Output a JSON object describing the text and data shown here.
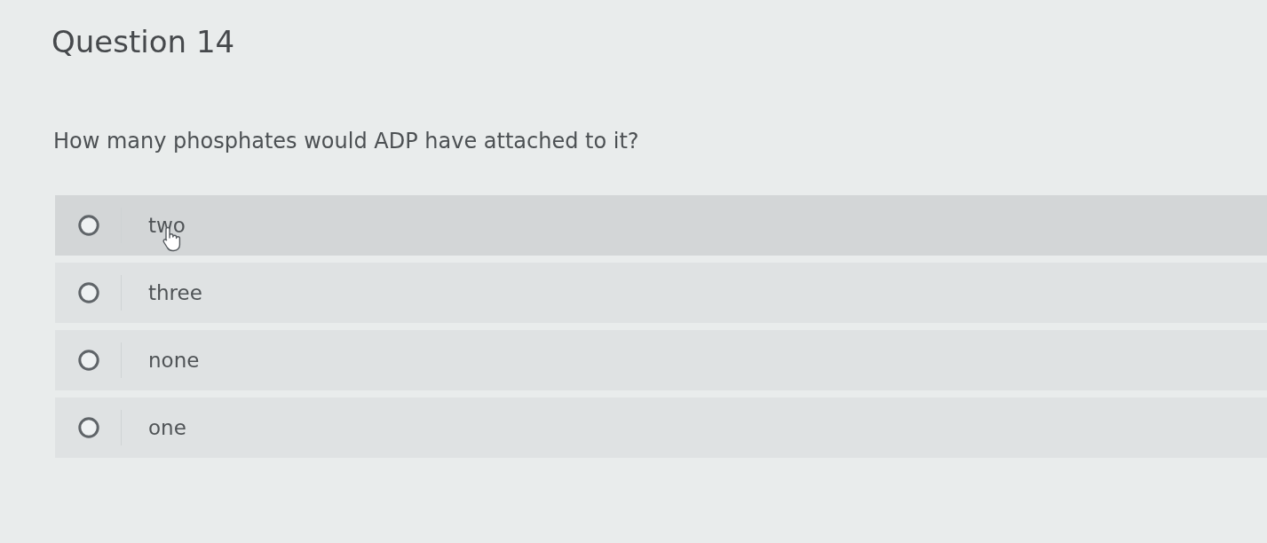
{
  "question": {
    "title": "Question 14",
    "text": "How many phosphates would ADP have attached to it?"
  },
  "options": [
    {
      "label": "two",
      "selected": false,
      "hovered": true
    },
    {
      "label": "three",
      "selected": false,
      "hovered": false
    },
    {
      "label": "none",
      "selected": false,
      "hovered": false
    },
    {
      "label": "one",
      "selected": false,
      "hovered": false
    }
  ]
}
